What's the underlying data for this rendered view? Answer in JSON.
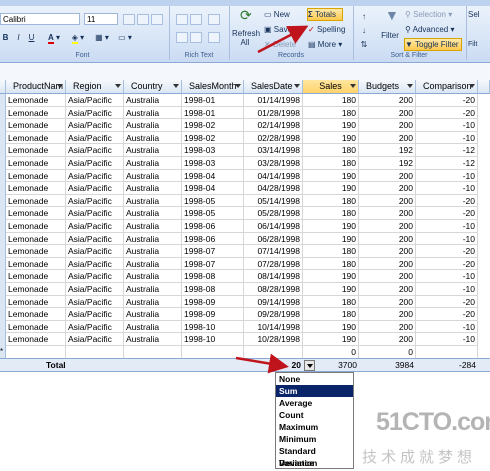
{
  "ribbon": {
    "font_name": "Calibri",
    "font_size": "11",
    "groups": {
      "font": "Font",
      "rich_text": "Rich Text",
      "records": "Records",
      "sort_filter": "Sort & Filter"
    },
    "records": {
      "refresh_label": "Refresh All",
      "new_label": "New",
      "save_label": "Save",
      "delete_label": "Delete",
      "totals_label": "Totals",
      "spelling_label": "Spelling",
      "more_label": "More"
    },
    "sort_filter": {
      "filter_label": "Filter",
      "selection_label": "Selection",
      "advanced_label": "Advanced",
      "toggle_filter_label": "Toggle Filter"
    },
    "right_edge": {
      "sel_label": "Sel",
      "filter_by_label": "Filt Font Size"
    }
  },
  "table": {
    "columns": [
      "ProductNam",
      "Region",
      "Country",
      "SalesMonth",
      "SalesDate",
      "Sales",
      "Budgets",
      "Comparison"
    ],
    "rows": [
      [
        "Lemonade",
        "Asia/Pacific",
        "Australia",
        "1998-01",
        "01/14/1998",
        "180",
        "200",
        "-20"
      ],
      [
        "Lemonade",
        "Asia/Pacific",
        "Australia",
        "1998-01",
        "01/28/1998",
        "180",
        "200",
        "-20"
      ],
      [
        "Lemonade",
        "Asia/Pacific",
        "Australia",
        "1998-02",
        "02/14/1998",
        "190",
        "200",
        "-10"
      ],
      [
        "Lemonade",
        "Asia/Pacific",
        "Australia",
        "1998-02",
        "02/28/1998",
        "190",
        "200",
        "-10"
      ],
      [
        "Lemonade",
        "Asia/Pacific",
        "Australia",
        "1998-03",
        "03/14/1998",
        "180",
        "192",
        "-12"
      ],
      [
        "Lemonade",
        "Asia/Pacific",
        "Australia",
        "1998-03",
        "03/28/1998",
        "180",
        "192",
        "-12"
      ],
      [
        "Lemonade",
        "Asia/Pacific",
        "Australia",
        "1998-04",
        "04/14/1998",
        "190",
        "200",
        "-10"
      ],
      [
        "Lemonade",
        "Asia/Pacific",
        "Australia",
        "1998-04",
        "04/28/1998",
        "190",
        "200",
        "-10"
      ],
      [
        "Lemonade",
        "Asia/Pacific",
        "Australia",
        "1998-05",
        "05/14/1998",
        "180",
        "200",
        "-20"
      ],
      [
        "Lemonade",
        "Asia/Pacific",
        "Australia",
        "1998-05",
        "05/28/1998",
        "180",
        "200",
        "-20"
      ],
      [
        "Lemonade",
        "Asia/Pacific",
        "Australia",
        "1998-06",
        "06/14/1998",
        "190",
        "200",
        "-10"
      ],
      [
        "Lemonade",
        "Asia/Pacific",
        "Australia",
        "1998-06",
        "06/28/1998",
        "190",
        "200",
        "-10"
      ],
      [
        "Lemonade",
        "Asia/Pacific",
        "Australia",
        "1998-07",
        "07/14/1998",
        "180",
        "200",
        "-20"
      ],
      [
        "Lemonade",
        "Asia/Pacific",
        "Australia",
        "1998-07",
        "07/28/1998",
        "180",
        "200",
        "-20"
      ],
      [
        "Lemonade",
        "Asia/Pacific",
        "Australia",
        "1998-08",
        "08/14/1998",
        "190",
        "200",
        "-10"
      ],
      [
        "Lemonade",
        "Asia/Pacific",
        "Australia",
        "1998-08",
        "08/28/1998",
        "190",
        "200",
        "-10"
      ],
      [
        "Lemonade",
        "Asia/Pacific",
        "Australia",
        "1998-09",
        "09/14/1998",
        "180",
        "200",
        "-20"
      ],
      [
        "Lemonade",
        "Asia/Pacific",
        "Australia",
        "1998-09",
        "09/28/1998",
        "180",
        "200",
        "-20"
      ],
      [
        "Lemonade",
        "Asia/Pacific",
        "Australia",
        "1998-10",
        "10/14/1998",
        "190",
        "200",
        "-10"
      ],
      [
        "Lemonade",
        "Asia/Pacific",
        "Australia",
        "1998-10",
        "10/28/1998",
        "190",
        "200",
        "-10"
      ]
    ],
    "new_row": {
      "marker": "*",
      "sales": "0",
      "budgets": "0"
    },
    "total_row": {
      "label": "Total",
      "sales_count": "20",
      "sales_sum": "3700",
      "budgets": "3984",
      "comparison": "-284"
    }
  },
  "dropdown": {
    "options": [
      "None",
      "Sum",
      "Average",
      "Count",
      "Maximum",
      "Minimum",
      "Standard Deviation",
      "Variance"
    ],
    "selected": "Sum"
  },
  "watermark": {
    "main": "51CTO.com",
    "sub": "技术成就梦想"
  },
  "colors": {
    "arrow": "#c0141c",
    "highlight": "#ffd36b",
    "selection": "#0a246a"
  }
}
